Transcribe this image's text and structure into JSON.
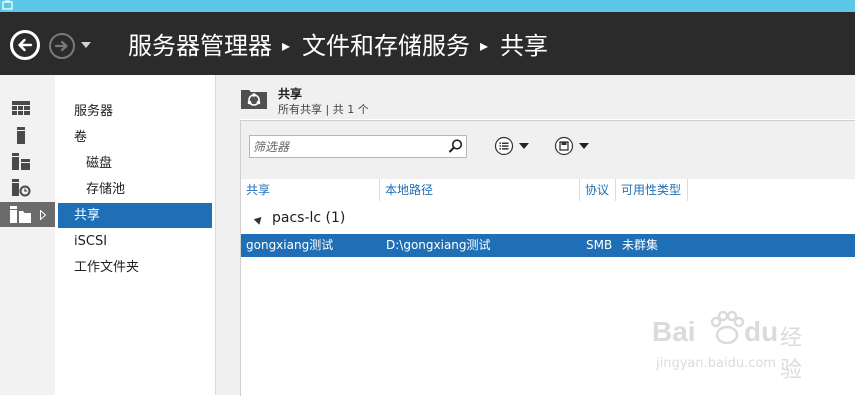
{
  "header": {
    "breadcrumb": [
      "服务器管理器",
      "文件和存储服务",
      "共享"
    ]
  },
  "rail": {
    "icons": [
      "dashboard-icon",
      "local-server-icon",
      "all-servers-icon",
      "file-storage-services-icon",
      "shares-folder-icon"
    ]
  },
  "nav": {
    "items": [
      {
        "label": "服务器"
      },
      {
        "label": "卷"
      },
      {
        "label": "磁盘"
      },
      {
        "label": "存储池"
      },
      {
        "label": "共享"
      },
      {
        "label": "iSCSI"
      },
      {
        "label": "工作文件夹"
      }
    ]
  },
  "section": {
    "title": "共享",
    "subtitle": "所有共享 | 共 1 个"
  },
  "filter": {
    "placeholder": "筛选器"
  },
  "table": {
    "columns": [
      "共享",
      "本地路径",
      "协议",
      "可用性类型"
    ],
    "group": "pacs-lc (1)",
    "rows": [
      {
        "share": "gongxiang测试",
        "path": "D:\\gongxiang测试",
        "protocol": "SMB",
        "availability": "未群集"
      }
    ]
  },
  "watermark": {
    "brand": "Bai",
    "brand2": "du",
    "suffix": "经验",
    "url": "jingyan.baidu.com"
  },
  "colors": {
    "accent": "#1f6fb6",
    "header_bg": "#2b2b2b",
    "title_strip": "#5bc8e8"
  }
}
